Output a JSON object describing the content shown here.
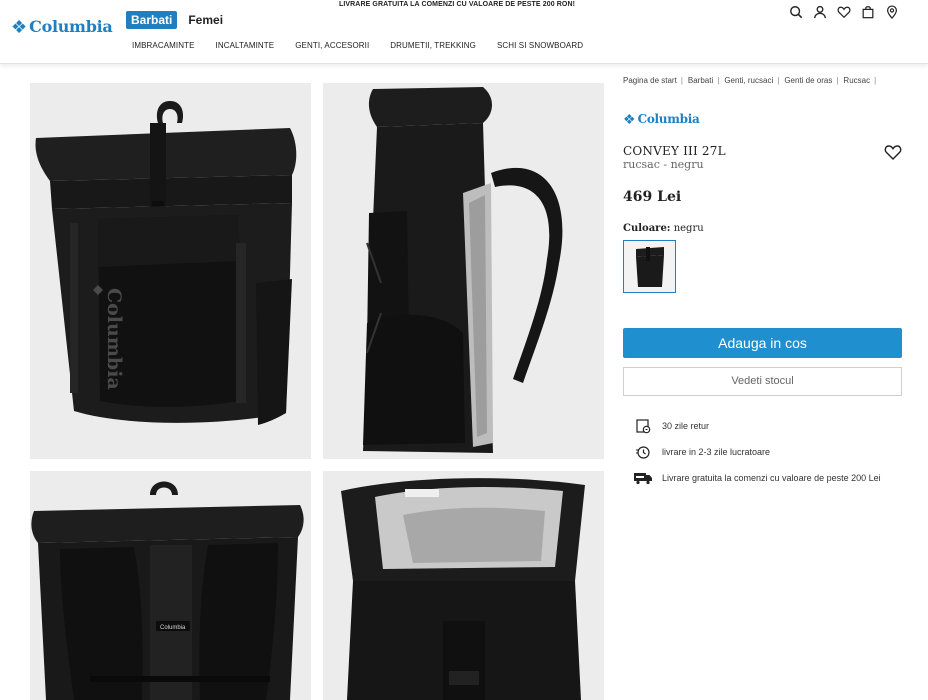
{
  "header": {
    "promo": "LIVRARE GRATUITA LA COMENZI CU VALOARE DE PESTE 200 RON!",
    "logo_text": "Columbia",
    "gender_tabs": [
      "Barbati",
      "Femei"
    ],
    "nav": [
      "IMBRACAMINTE",
      "INCALTAMINTE",
      "GENTI, ACCESORII",
      "DRUMETII, TREKKING",
      "SCHI SI SNOWBOARD"
    ],
    "icons": [
      "search-icon",
      "account-icon",
      "heart-icon",
      "bag-icon",
      "location-icon"
    ]
  },
  "breadcrumb": [
    "Pagina de start",
    "Barbati",
    "Genti, rucsaci",
    "Genti de oras",
    "Rucsac"
  ],
  "product": {
    "brand": "Columbia",
    "title": "CONVEY III 27L",
    "subtitle": "rucsac - negru",
    "price": "469 Lei",
    "color_label": "Culoare:",
    "color_value": "negru",
    "add_to_cart": "Adauga in cos",
    "check_stock": "Vedeti stocul"
  },
  "features": [
    {
      "icon": "return-icon",
      "text": "30 zile retur"
    },
    {
      "icon": "delivery-time-icon",
      "text": "livrare in 2-3 zile lucratoare"
    },
    {
      "icon": "free-shipping-icon",
      "text": "Livrare gratuita la comenzi cu valoare de peste 200 Lei"
    }
  ],
  "gallery_labels": {
    "front_logo": "Columbia",
    "back_tag": "Columbia"
  },
  "colors": {
    "brand_blue": "#1f7fc1",
    "button_blue": "#1f8fd0",
    "image_bg": "#ececec"
  }
}
